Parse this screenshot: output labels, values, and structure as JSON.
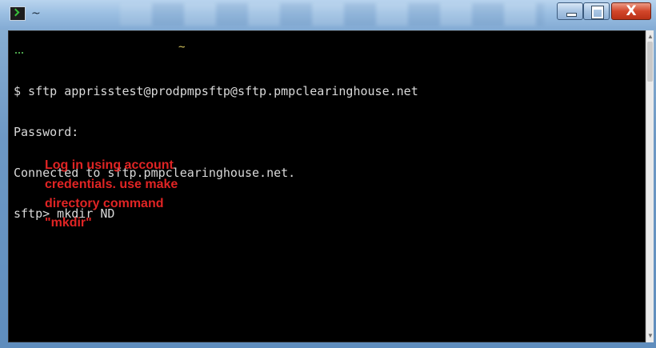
{
  "window": {
    "title": "~",
    "controls": {
      "minimize_icon": "minimize-icon",
      "maximize_icon": "maximize-icon",
      "close_label": "X"
    }
  },
  "terminal": {
    "cwd_marker": "~",
    "lines": [
      "$ sftp apprisstest@prodpmpsftp@sftp.pmpclearinghouse.net",
      "Password:",
      "Connected to sftp.pmpclearinghouse.net.",
      "sftp> mkdir ND"
    ]
  },
  "annotation": {
    "lines": [
      "Log in using account",
      "credentials.  use make",
      "directory command",
      "\"mkdir\""
    ],
    "color": "#e02424"
  },
  "colors": {
    "terminal_bg": "#000000",
    "terminal_text": "#d9d9d9",
    "titlebar": "#9bbfe2",
    "close_button": "#d2462a"
  }
}
